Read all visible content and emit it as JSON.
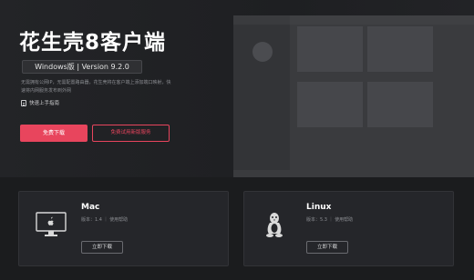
{
  "hero": {
    "title": "花生壳8客户端",
    "version": "Windows版 | Version 9.2.0",
    "description": "无需拥有公网IP，无需配置路由器，花生壳将在客户端上添加端口映射，快速将内网服务发布到外网",
    "guide_link": "快速上手指南",
    "primary_button": "免费下载",
    "secondary_button": "免费试用新版服务"
  },
  "downloads": [
    {
      "name": "Mac",
      "meta": "版本：1.4 ｜ 使用帮助",
      "button": "立即下载",
      "icon": "apple-monitor-icon"
    },
    {
      "name": "Linux",
      "meta": "版本：5.3 ｜ 使用帮助",
      "button": "立即下载",
      "icon": "linux-penguin-icon"
    }
  ],
  "colors": {
    "accent": "#e8455d",
    "background": "#1b1c1e",
    "card": "#25262a"
  }
}
